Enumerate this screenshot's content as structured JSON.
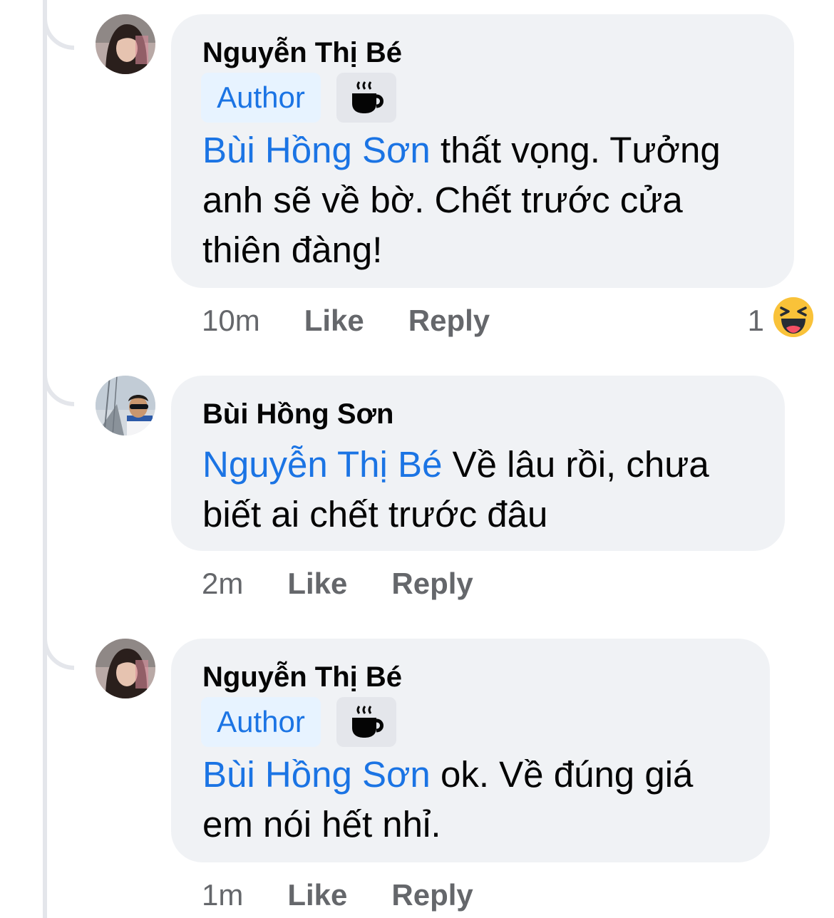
{
  "comments": [
    {
      "author": "Nguyễn Thị Bé",
      "badge": "Author",
      "badge_icon": "coffee-cup-icon",
      "mention": "Bùi Hồng Sơn",
      "text_line1": " thất vọng. Tưởng",
      "text_line2": "anh sẽ về bờ. Chết trước cửa",
      "text_line3": "thiên đàng!",
      "time": "10m",
      "like": "Like",
      "reply": "Reply",
      "reaction_count": "1",
      "reaction_icon": "laughing-face-icon"
    },
    {
      "author": "Bùi Hồng Sơn",
      "mention": "Nguyễn Thị Bé",
      "text_line1": " Về lâu rồi, chưa",
      "text_line2": "biết ai chết trước đâu",
      "time": "2m",
      "like": "Like",
      "reply": "Reply"
    },
    {
      "author": "Nguyễn Thị Bé",
      "badge": "Author",
      "badge_icon": "coffee-cup-icon",
      "mention": "Bùi Hồng Sơn",
      "text_line1": " ok. Về đúng giá",
      "text_line2": "em nói hết nhỉ.",
      "time": "1m",
      "like": "Like",
      "reply": "Reply"
    }
  ],
  "colors": {
    "bubble": "#f0f2f5",
    "mention": "#1b74e4",
    "meta": "#65676b",
    "badge_bg": "#e7f3ff"
  }
}
